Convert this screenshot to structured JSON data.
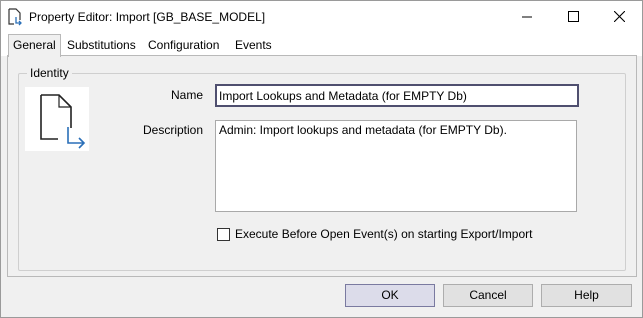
{
  "window": {
    "title": "Property Editor: Import [GB_BASE_MODEL]",
    "controls": {
      "minimize": "minimize-icon",
      "maximize": "maximize-icon",
      "close": "close-icon"
    }
  },
  "tabs": [
    {
      "label": "General",
      "active": true
    },
    {
      "label": "Substitutions",
      "active": false
    },
    {
      "label": "Configuration",
      "active": false
    },
    {
      "label": "Events",
      "active": false
    }
  ],
  "identity": {
    "group_label": "Identity",
    "icon": "document-import-icon",
    "name_label": "Name",
    "name_value": "Import Lookups and Metadata (for EMPTY Db)",
    "description_label": "Description",
    "description_value": "Admin: Import lookups and metadata (for EMPTY Db).",
    "execute_before_open_label": "Execute Before Open Event(s) on starting Export/Import",
    "execute_before_open_checked": false
  },
  "buttons": {
    "ok": "OK",
    "cancel": "Cancel",
    "help": "Help"
  },
  "colors": {
    "accent_blue": "#2a6fb8",
    "window_bg": "#f0f0f0"
  }
}
